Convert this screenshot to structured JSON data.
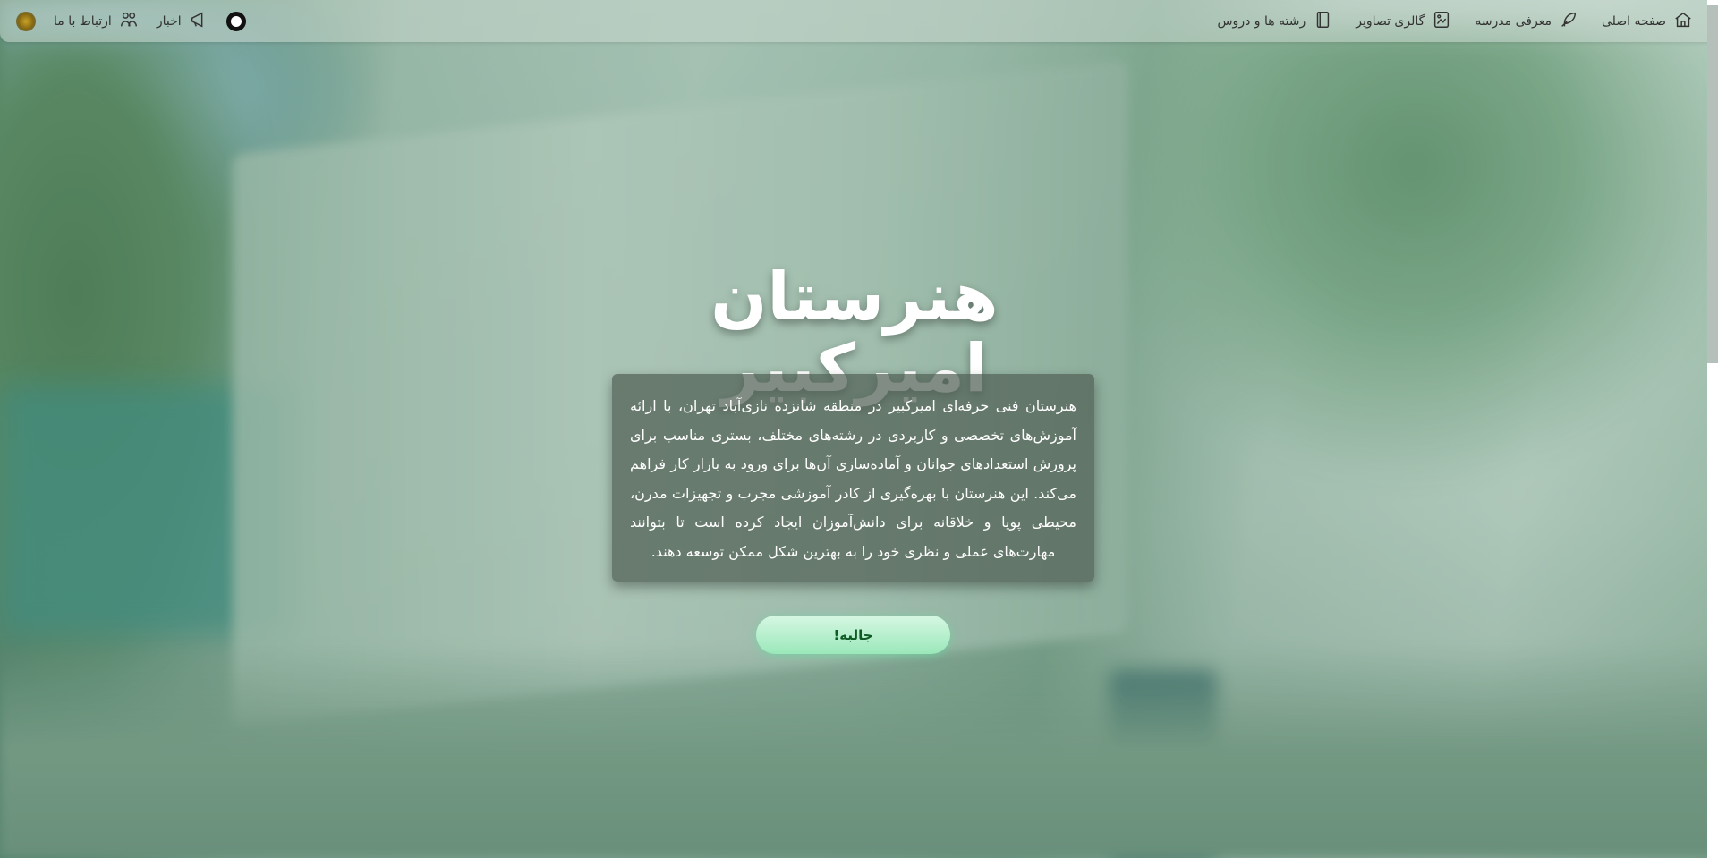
{
  "nav": {
    "items": [
      {
        "label": "صفحه اصلی",
        "icon": "home-icon"
      },
      {
        "label": "معرفی مدرسه",
        "icon": "feather-icon"
      },
      {
        "label": "گالری تصاویر",
        "icon": "gallery-icon"
      },
      {
        "label": "رشته ها و دروس",
        "icon": "book-icon"
      }
    ],
    "left_items": [
      {
        "label": "اخبار",
        "icon": "megaphone-icon"
      },
      {
        "label": "ارتباط با ما",
        "icon": "people-icon"
      }
    ]
  },
  "hero": {
    "title": "هنرستان امیرکبیر",
    "description": "هنرستان فنی حرفه‌ای امیرکبیر در منطقه شانزده نازی‌آباد تهران، با ارائه آموزش‌های تخصصی و کاربردی در رشته‌های مختلف، بستری مناسب برای پرورش استعدادهای جوانان و آماده‌سازی آن‌ها برای ورود به بازار کار فراهم می‌کند. این هنرستان با بهره‌گیری از کادر آموزشی مجرب و تجهیزات مدرن، محیطی پویا و خلاقانه برای دانش‌آموزان ایجاد کرده است تا بتوانند مهارت‌های عملی و نظری خود را به بهترین شکل ممکن توسعه دهند.",
    "cta": "جالبه!"
  },
  "colors": {
    "accent": "#9be8ba",
    "cta_text": "#0e5b23"
  }
}
